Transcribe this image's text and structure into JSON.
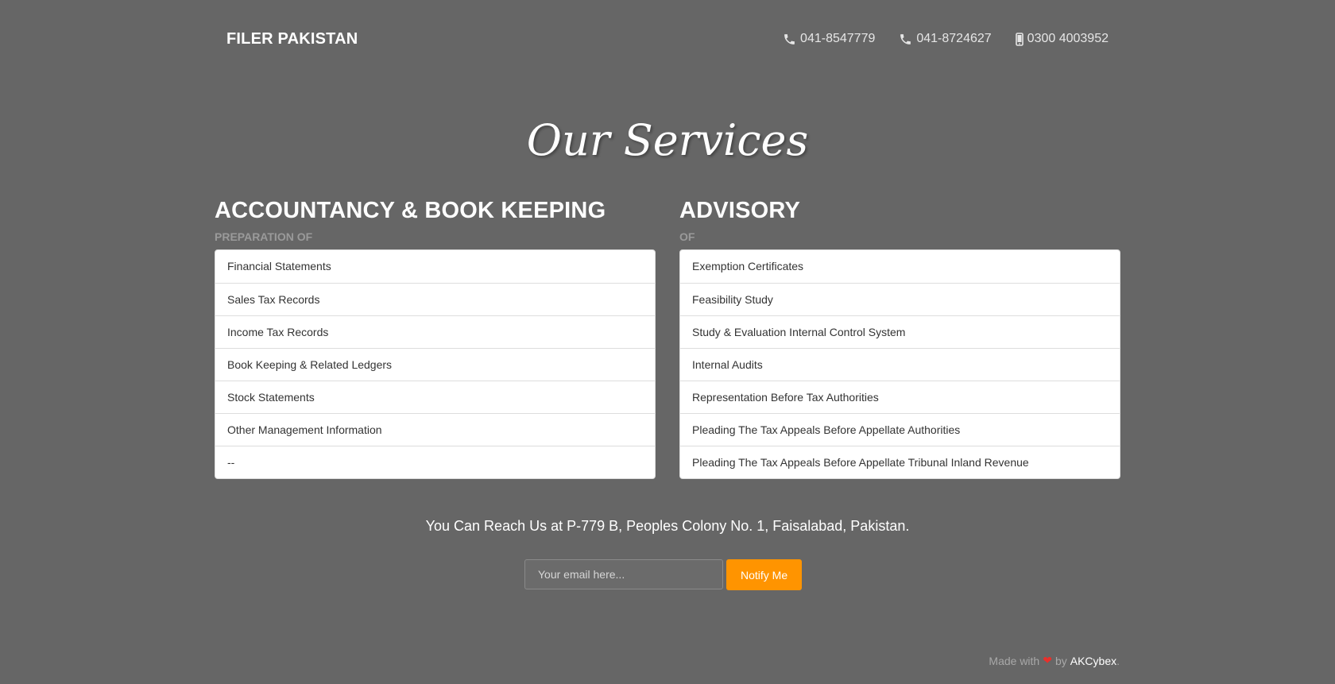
{
  "header": {
    "brand": "FILER PAKISTAN",
    "contacts": [
      {
        "icon": "phone-icon",
        "number": "041-8547779"
      },
      {
        "icon": "phone-icon",
        "number": "041-8724627"
      },
      {
        "icon": "mobile-icon",
        "number": "0300 4003952"
      }
    ]
  },
  "main": {
    "title": "Our Services",
    "sections": [
      {
        "heading": "ACCOUNTANCY & BOOK KEEPING",
        "subheading": "PREPARATION OF",
        "items": [
          "Financial Statements",
          "Sales Tax Records",
          "Income Tax Records",
          "Book Keeping & Related Ledgers",
          "Stock Statements",
          "Other Management Information",
          "--"
        ]
      },
      {
        "heading": "ADVISORY",
        "subheading": "OF",
        "items": [
          "Exemption Certificates",
          "Feasibility Study",
          "Study & Evaluation Internal Control System",
          "Internal Audits",
          "Representation Before Tax Authorities",
          "Pleading The Tax Appeals Before Appellate Authorities",
          "Pleading The Tax Appeals Before Appellate Tribunal Inland Revenue"
        ]
      }
    ],
    "reach_text": "You Can Reach Us at P-779 B, Peoples Colony No. 1, Faisalabad, Pakistan.",
    "email_placeholder": "Your email here...",
    "notify_label": "Notify Me"
  },
  "footer": {
    "made_with": "Made with",
    "by": "by",
    "author": "AKCybex",
    "period": "."
  },
  "colors": {
    "background": "#666666",
    "accent": "#ff9400",
    "heart": "#e8302b"
  }
}
